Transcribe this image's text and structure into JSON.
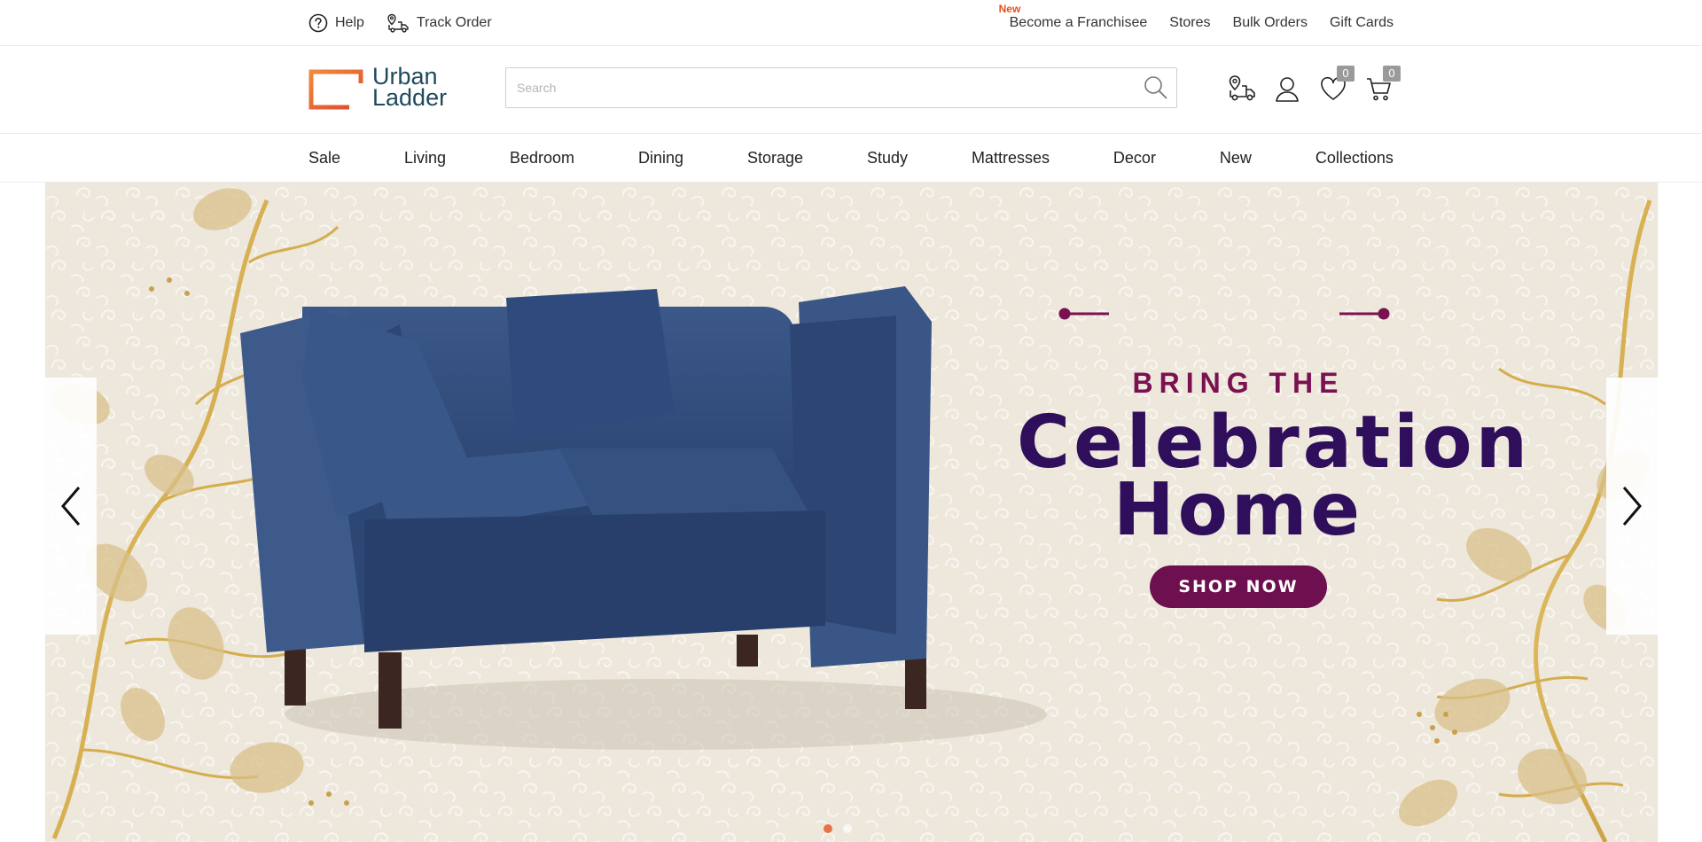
{
  "top_bar": {
    "help_label": "Help",
    "track_order_label": "Track Order",
    "new_tag": "New",
    "links": [
      "Become a Franchisee",
      "Stores",
      "Bulk Orders",
      "Gift Cards"
    ]
  },
  "header": {
    "logo_line1": "Urban",
    "logo_line2": "Ladder",
    "search_placeholder": "Search",
    "wishlist_count": "0",
    "cart_count": "0",
    "icons": [
      "store-locator-icon",
      "account-icon",
      "wishlist-heart-icon",
      "cart-icon"
    ]
  },
  "categories": [
    "Sale",
    "Living",
    "Bedroom",
    "Dining",
    "Storage",
    "Study",
    "Mattresses",
    "Decor",
    "New",
    "Collections"
  ],
  "hero": {
    "tagline": "BRING THE",
    "headline_line1": "Celebration",
    "headline_line2": "Home",
    "cta": "SHOP NOW",
    "active_slide": 1,
    "colors": {
      "tagline": "#7a1150",
      "headline": "#2f0f5b",
      "cta_bg": "#6e0f4f",
      "sofa": "#2e4a78",
      "background": "#ede7dc",
      "dot_active": "#e8734a"
    }
  },
  "brand_colors": {
    "logo_orange": "#e8734a",
    "logo_text": "#1f4a5c"
  }
}
